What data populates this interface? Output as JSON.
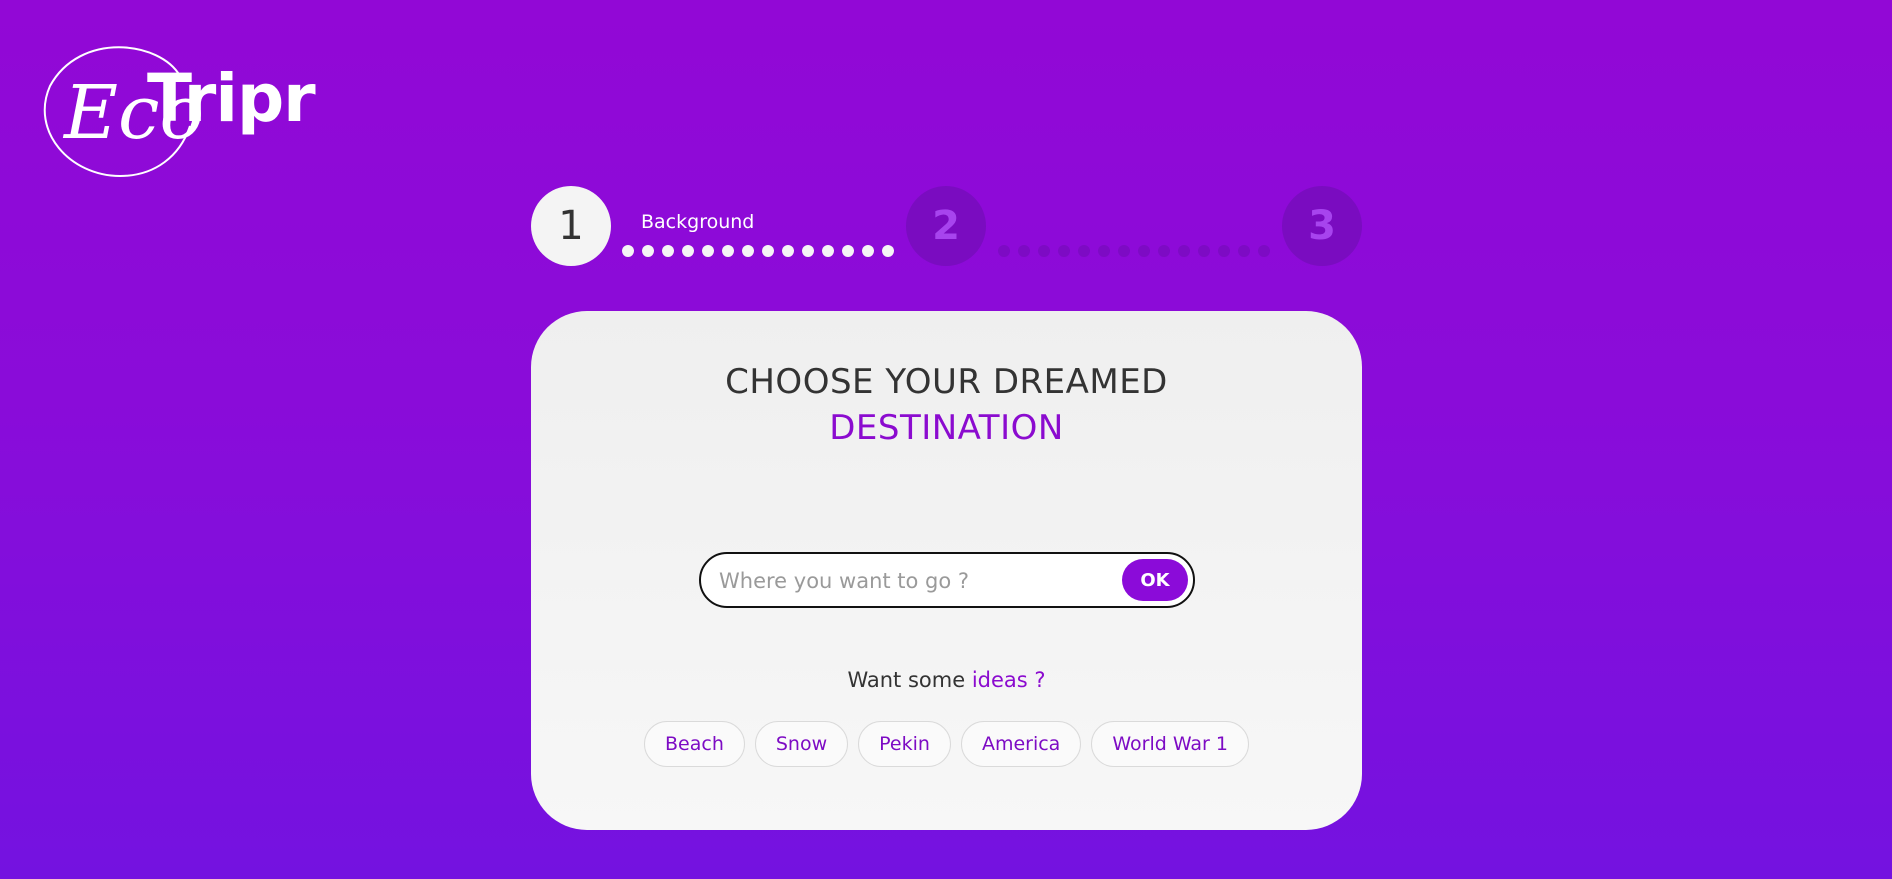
{
  "brand": {
    "logo_top": "Tripr",
    "logo_script": "Eco"
  },
  "stepper": {
    "steps": [
      {
        "number": "1",
        "label": "Background"
      },
      {
        "number": "2"
      },
      {
        "number": "3"
      }
    ]
  },
  "card": {
    "title_line1": "CHOOSE YOUR DREAMED",
    "title_line2": "DESTINATION",
    "search": {
      "placeholder": "Where you want to go ?",
      "value": "",
      "button_label": "OK"
    },
    "ideas_prefix": "Want some",
    "ideas_accent": "ideas ?",
    "chips": [
      "Beach",
      "Snow",
      "Pekin",
      "America",
      "World War 1"
    ]
  },
  "colors": {
    "background_top": "#9208d6",
    "background_bottom": "#7412e0",
    "accent": "#8b0bcf",
    "card": "#f4f4f4",
    "inactive_step": "#7a0cc0"
  }
}
